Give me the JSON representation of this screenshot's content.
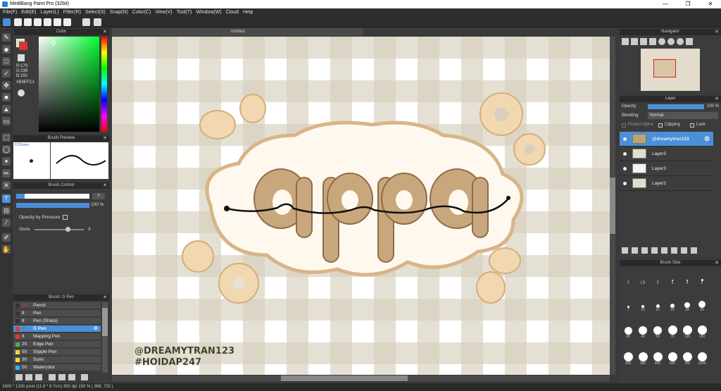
{
  "window": {
    "title": "MediBang Paint Pro (32bit)",
    "minimize": "—",
    "maximize": "❐",
    "close": "✕"
  },
  "menu": [
    "File(F)",
    "Edit(E)",
    "Layer(L)",
    "Filter(R)",
    "Select(S)",
    "Snap(N)",
    "Color(C)",
    "View(V)",
    "Tool(T)",
    "Window(W)",
    "Cloud",
    "Help"
  ],
  "color_panel": {
    "title": "Color",
    "r": "R:179",
    "g": "G:239",
    "b": "B:193",
    "hex": "#B3EFC1"
  },
  "brush_preview": {
    "title": "Brush Preview",
    "size": "0.51mm"
  },
  "brush_control": {
    "title": "Brush Control",
    "size_value": "7",
    "opacity_value": "100 %",
    "opacity_pressure_label": "Opacity by Pressure",
    "ooze_label": "Ooze",
    "ooze_value": "3"
  },
  "brush_list": {
    "title": "Brush: G Pen",
    "items": [
      {
        "size": "20",
        "name": "Pencil",
        "color": "#333333"
      },
      {
        "size": "8",
        "name": "Pen",
        "color": "#333333"
      },
      {
        "size": "8",
        "name": "Pen (Sharp)",
        "color": "#333333"
      },
      {
        "size": "7",
        "name": "G Pen",
        "color": "#e53935",
        "selected": true
      },
      {
        "size": "8",
        "name": "Mapping Pen",
        "color": "#e53935"
      },
      {
        "size": "20",
        "name": "Edge Pen",
        "color": "#4caf50"
      },
      {
        "size": "50",
        "name": "Stipple Pen",
        "color": "#fdd835"
      },
      {
        "size": "30",
        "name": "Sumi",
        "color": "#fdd835"
      },
      {
        "size": "50",
        "name": "Watercolor",
        "color": "#29b6f6"
      }
    ]
  },
  "document": {
    "tab": "Untitled"
  },
  "canvas_text": {
    "line1": "@DREAMYTRAN123",
    "line2": "#HOIDAP247",
    "lettering": "a p p a"
  },
  "navigator": {
    "title": "Navigator"
  },
  "layer_panel": {
    "title": "Layer",
    "opacity_label": "Opacity",
    "opacity_value": "100 %",
    "blending_label": "Blending",
    "blending_value": "Normal",
    "protect_alpha": "Protect Alpha",
    "clipping": "Clipping",
    "lock": "Lock",
    "layers": [
      {
        "name": "@dreamytran123",
        "selected": true
      },
      {
        "name": "Layer3"
      },
      {
        "name": "Layer3"
      },
      {
        "name": "Layer2"
      }
    ]
  },
  "brush_size": {
    "title": "Brush Size",
    "sizes": [
      "1",
      "1.5",
      "2",
      "3",
      "4",
      "5",
      "7",
      "10",
      "12",
      "15",
      "20",
      "25",
      "30",
      "40",
      "50",
      "70",
      "100",
      "150",
      "200",
      "300",
      "400",
      "500",
      "700",
      "1000"
    ]
  },
  "status": {
    "text": "1600 * 1200 pixel   (11.6 * 8.7cm)   350 dpi   150 %   ( 368, 732 )"
  },
  "colors": {
    "accent": "#4a90d9",
    "bg": "#3a3a3a",
    "canvas_tan": "#d8cfbd",
    "panel": "#3c3c3c"
  }
}
